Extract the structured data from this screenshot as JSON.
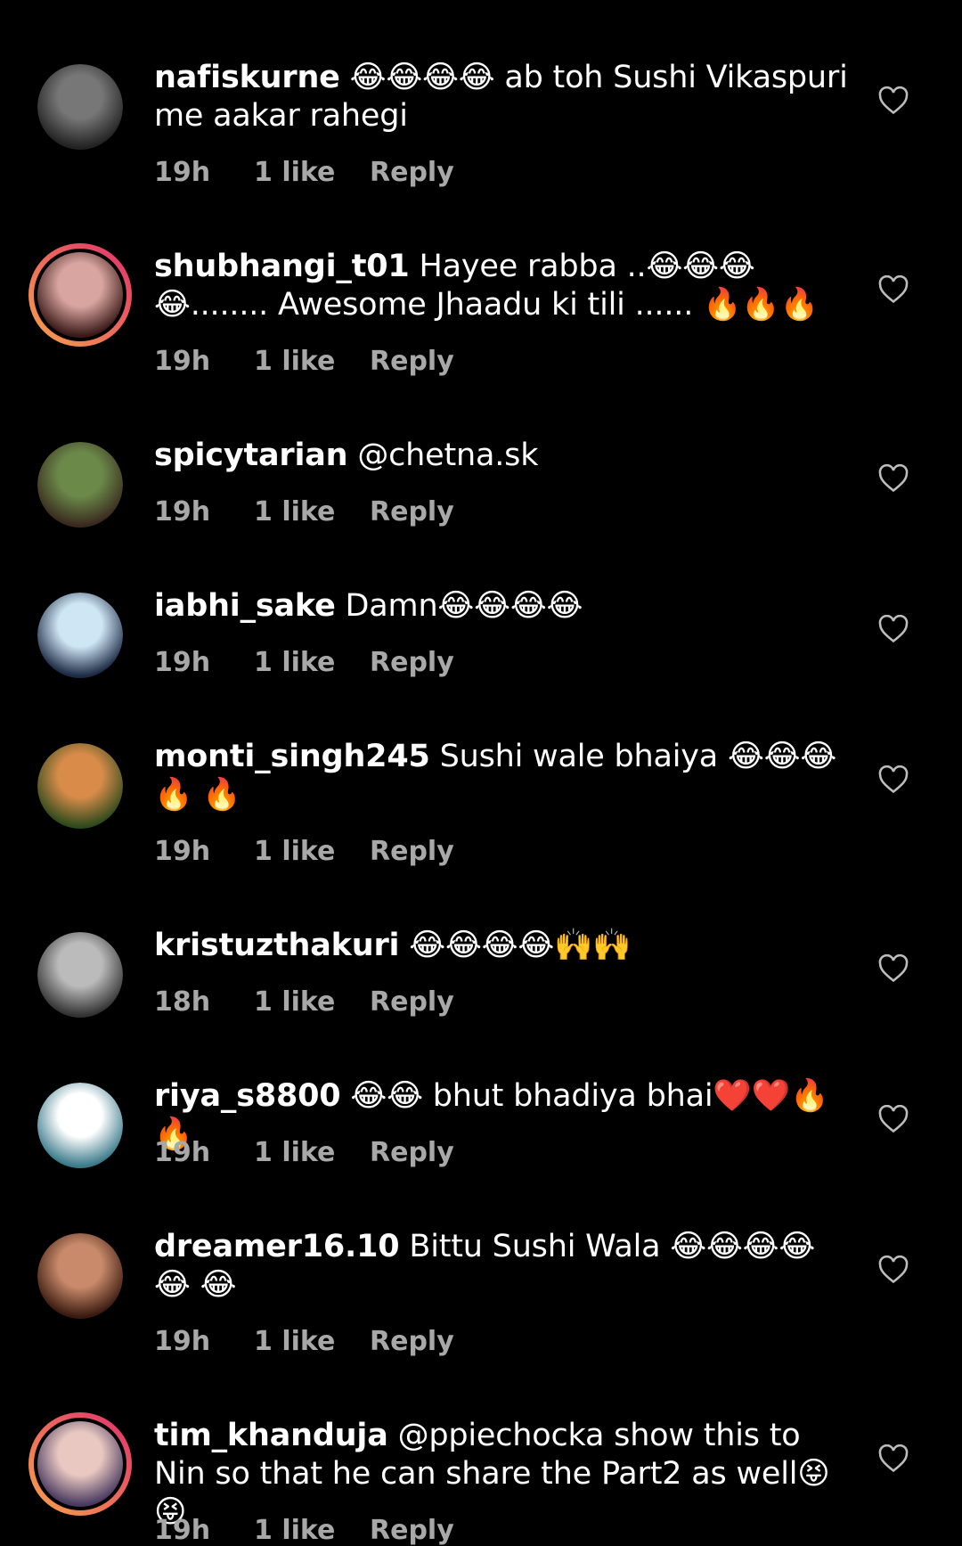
{
  "reply_label": "Reply",
  "comments": [
    {
      "username": "nafiskurne",
      "text": "😂😂😂😂 ab toh Sushi Vikaspuri me aakar rahegi",
      "time": "19h",
      "likes": "1 like",
      "avatar_colors": [
        "#777",
        "#222"
      ],
      "ring": false
    },
    {
      "username": "shubhangi_t01",
      "text": "Hayee rabba ..😂😂😂😂........ Awesome Jhaadu ki tili ...... 🔥🔥🔥",
      "time": "19h",
      "likes": "1 like",
      "avatar_colors": [
        "#d9a5a0",
        "#3a1a18"
      ],
      "ring": true
    },
    {
      "username": "spicytarian",
      "text": "@chetna.sk",
      "time": "19h",
      "likes": "1 like",
      "avatar_colors": [
        "#6b8a4a",
        "#3a2a1e"
      ],
      "ring": false
    },
    {
      "username": "iabhi_sake",
      "text": "Damn😂😂😂😂",
      "time": "19h",
      "likes": "1 like",
      "avatar_colors": [
        "#cfe6f5",
        "#1c2a44"
      ],
      "ring": false
    },
    {
      "username": "monti_singh245",
      "text": "Sushi wale bhaiya 😂😂😂🔥 🔥",
      "time": "19h",
      "likes": "1 like",
      "avatar_colors": [
        "#d98c4a",
        "#2e4a1c"
      ],
      "ring": false
    },
    {
      "username": "kristuzthakuri",
      "text": "😂😂😂😂🙌🙌",
      "time": "18h",
      "likes": "1 like",
      "avatar_colors": [
        "#bbb",
        "#333"
      ],
      "ring": false
    },
    {
      "username": "riya_s8800",
      "text": "😂😂 bhut bhadiya bhai❤️❤️🔥🔥",
      "time": "19h",
      "likes": "1 like",
      "avatar_colors": [
        "#ffffff",
        "#3a7a8a"
      ],
      "ring": false
    },
    {
      "username": "dreamer16.10",
      "text": "Bittu Sushi Wala 😂😂😂😂😂 😂",
      "time": "19h",
      "likes": "1 like",
      "avatar_colors": [
        "#c88a6a",
        "#3a1a10"
      ],
      "ring": false
    },
    {
      "username": "tim_khanduja",
      "text": "@ppiechocka show this to Nin so that he can share the Part2 as well😝😝",
      "time": "19h",
      "likes": "1 like",
      "avatar_colors": [
        "#e8c8c0",
        "#4a3a60"
      ],
      "ring": true
    }
  ],
  "colors": {
    "background": "#000000",
    "text": "#ffffff",
    "meta": "#a8a8a8",
    "ring_start": "#e1306c",
    "ring_end": "#f7a34a"
  },
  "icons": {
    "heart": "heart-outline-icon"
  }
}
